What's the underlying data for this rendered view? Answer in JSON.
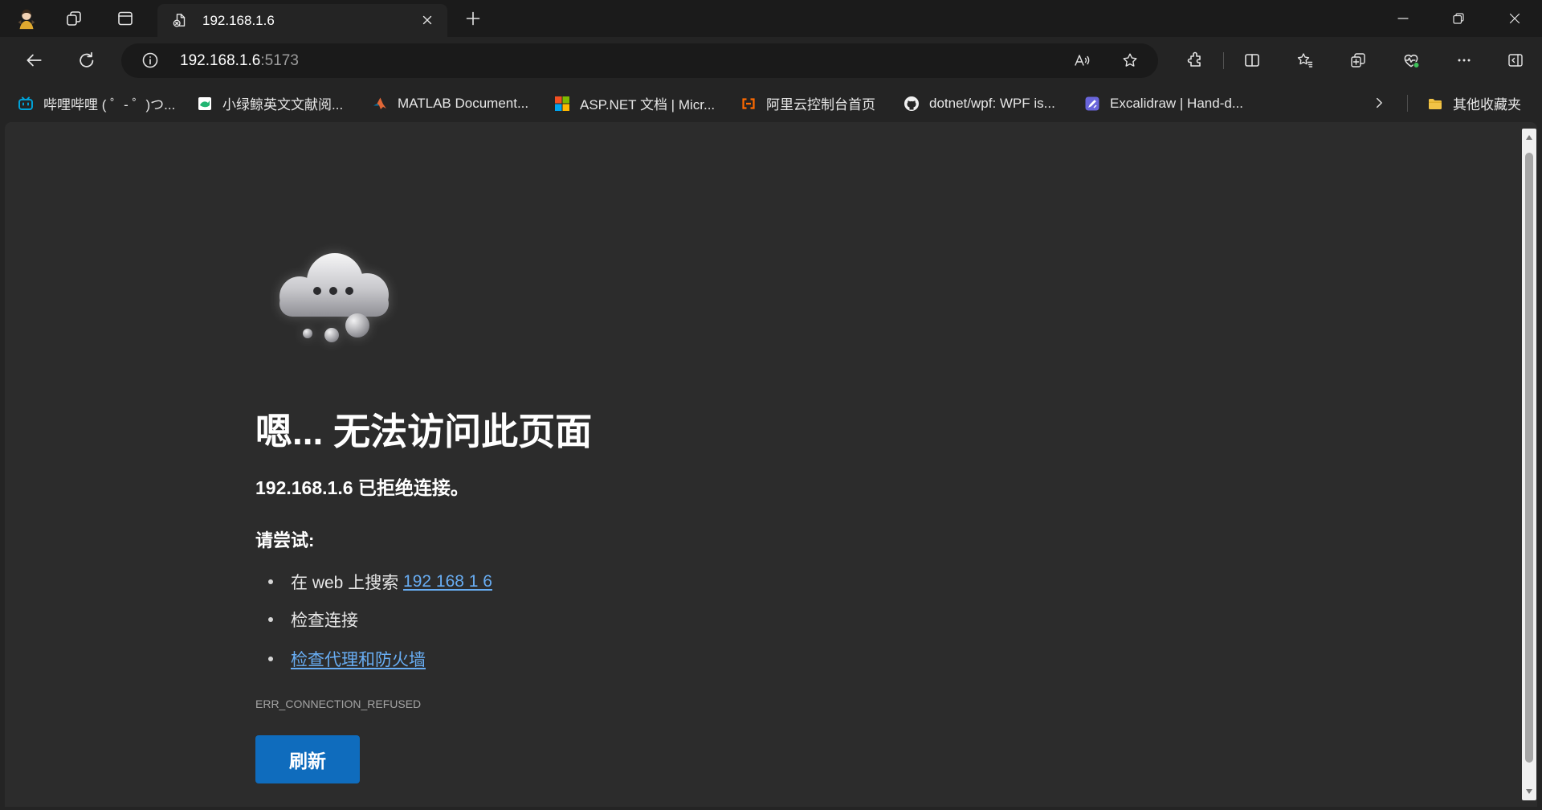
{
  "tab": {
    "title": "192.168.1.6"
  },
  "address_bar": {
    "host": "192.168.1.6",
    "port": ":5173"
  },
  "bookmarks": [
    {
      "label": "哔哩哔哩 ( ゜- ゜)つ...",
      "icon": "bilibili-icon"
    },
    {
      "label": "小绿鲸英文文献阅...",
      "icon": "xiaolvjing-icon"
    },
    {
      "label": "MATLAB Document...",
      "icon": "matlab-icon"
    },
    {
      "label": "ASP.NET 文档 | Micr...",
      "icon": "microsoft-icon"
    },
    {
      "label": "阿里云控制台首页",
      "icon": "aliyun-icon"
    },
    {
      "label": "dotnet/wpf: WPF is...",
      "icon": "github-icon"
    },
    {
      "label": "Excalidraw | Hand-d...",
      "icon": "excalidraw-icon"
    }
  ],
  "other_favorites": {
    "label": "其他收藏夹",
    "icon": "folder-icon"
  },
  "chrome_icons": {
    "tabstrip": [
      "profile-avatar",
      "workspaces-icon",
      "tab-actions-icon",
      "page-error-favicon",
      "close-tab-icon",
      "new-tab-icon",
      "minimize-icon",
      "restore-icon",
      "close-window-icon"
    ],
    "toolbar": [
      "back-icon",
      "refresh-icon",
      "info-icon",
      "read-aloud-icon",
      "favorite-star-icon",
      "extensions-icon",
      "split-screen-icon",
      "favorites-icon",
      "collections-icon",
      "browser-essentials-icon",
      "more-icon",
      "sidebar-icon"
    ],
    "bookmarks_overflow": "chevron-right-icon"
  },
  "error_page": {
    "illustration": "cloud-thinking-icon",
    "title": "嗯... 无法访问此页面",
    "message": "192.168.1.6 已拒绝连接。",
    "try_heading": "请尝试:",
    "suggestions": [
      {
        "prefix": "在 web 上搜索 ",
        "link": "192 168 1 6"
      },
      {
        "text": "检查连接"
      },
      {
        "link": "检查代理和防火墙"
      }
    ],
    "error_code": "ERR_CONNECTION_REFUSED",
    "refresh_label": "刷新"
  },
  "colors": {
    "tabstrip": "#1b1b1b",
    "chrome": "#242424",
    "address_pill": "#1a1a1a",
    "page_background": "#2c2c2c",
    "accent_button": "#0f6cbd",
    "link": "#68adf3",
    "muted_text": "#a3a3a3"
  }
}
